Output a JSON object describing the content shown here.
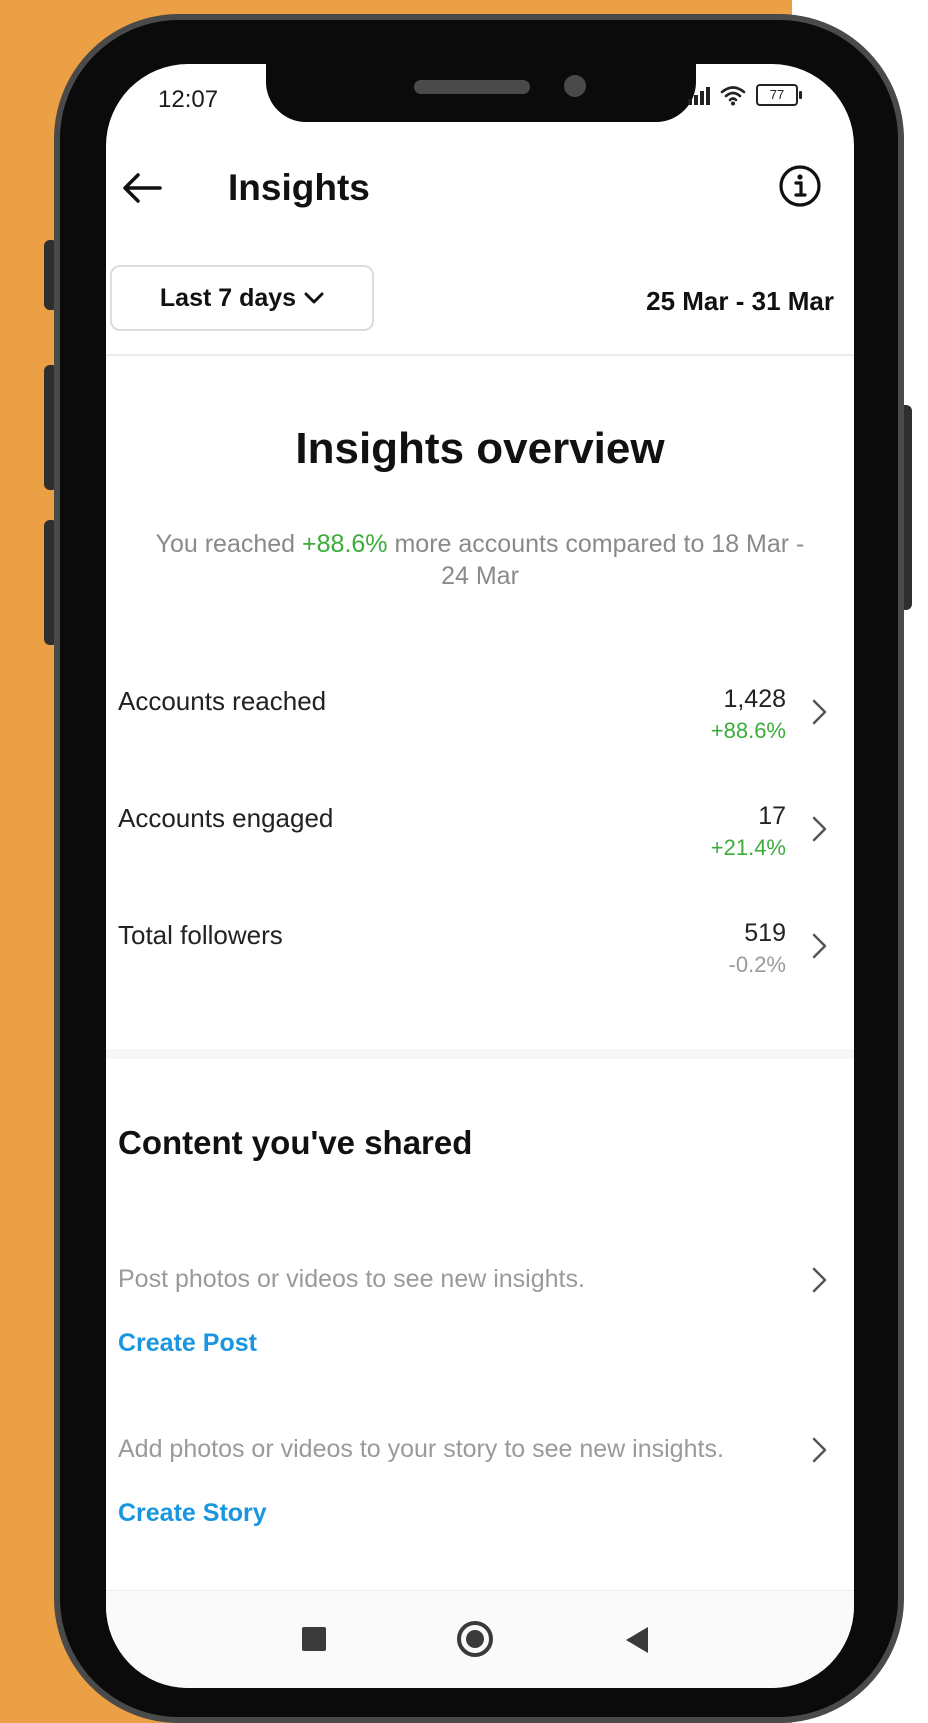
{
  "status_bar": {
    "time": "12:07",
    "battery": "77"
  },
  "header": {
    "title": "Insights"
  },
  "filter": {
    "range_label": "Last 7 days",
    "date_range": "25 Mar - 31 Mar"
  },
  "overview": {
    "title": "Insights overview",
    "summary_prefix": "You reached ",
    "summary_change": "+88.6%",
    "summary_suffix": " more accounts compared to 18 Mar - 24 Mar"
  },
  "metrics": [
    {
      "label": "Accounts reached",
      "value": "1,428",
      "change": "+88.6%",
      "change_color": "#3aad39"
    },
    {
      "label": "Accounts engaged",
      "value": "17",
      "change": "+21.4%",
      "change_color": "#3aad39"
    },
    {
      "label": "Total followers",
      "value": "519",
      "change": "-0.2%",
      "change_color": "#9a9a9a"
    }
  ],
  "content_shared": {
    "title": "Content you've shared",
    "items": [
      {
        "text": "Post photos or videos to see new insights.",
        "action": "Create Post"
      },
      {
        "text": "Add photos or videos to your story to see new insights.",
        "action": "Create Story"
      }
    ]
  },
  "colors": {
    "background": "#EBA045",
    "positive": "#3aad39",
    "link": "#1a96e0"
  },
  "icons": [
    "back-arrow-icon",
    "info-icon",
    "chevron-down-icon",
    "chevron-right-icon",
    "signal-icon",
    "wifi-icon",
    "battery-icon",
    "nav-recents-icon",
    "nav-home-icon",
    "nav-back-icon"
  ]
}
